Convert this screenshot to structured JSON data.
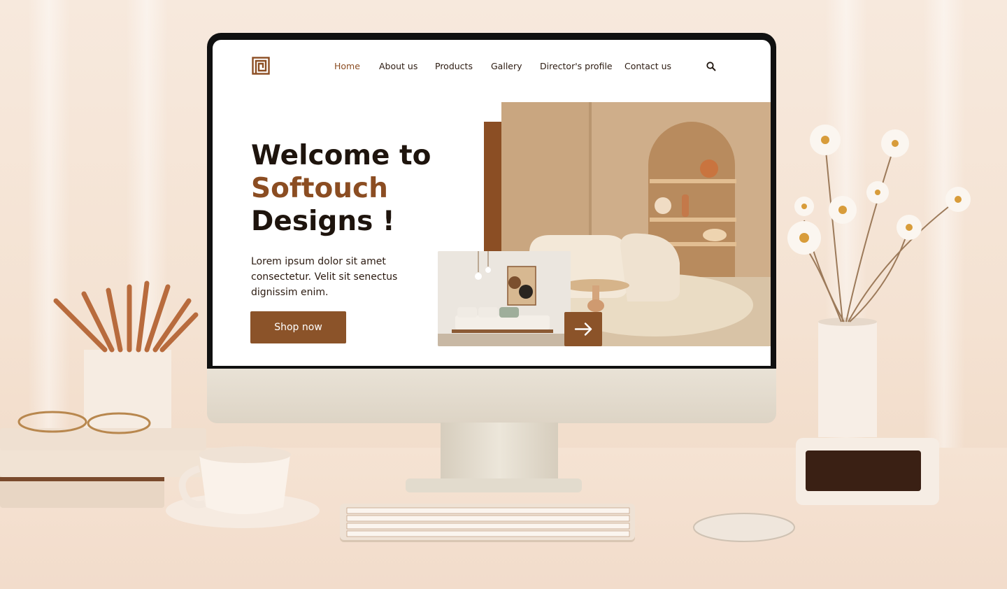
{
  "nav": {
    "items": [
      {
        "label": "Home",
        "active": true
      },
      {
        "label": "About us"
      },
      {
        "label": "Products"
      },
      {
        "label": "Gallery"
      },
      {
        "label": "Director's profile"
      },
      {
        "label": "Contact us"
      }
    ]
  },
  "hero": {
    "title_line1": "Welcome to",
    "title_line2": "Softouch",
    "title_line3": "Designs !",
    "body": "Lorem ipsum dolor sit amet consectetur. Velit sit senectus dignissim enim.",
    "cta": "Shop now"
  },
  "colors": {
    "brand": "#8b4d22",
    "text": "#1e140d",
    "button": "#8b5329"
  },
  "icons": [
    "logo-icon",
    "search-icon",
    "arrow-right-icon"
  ]
}
